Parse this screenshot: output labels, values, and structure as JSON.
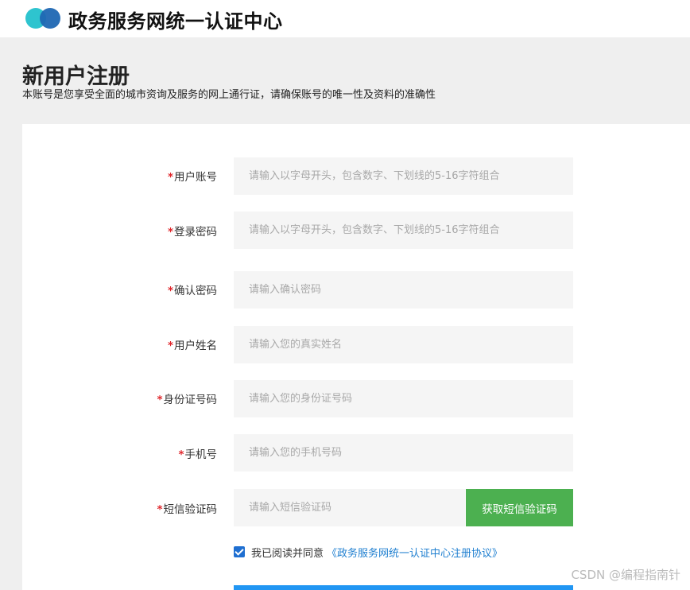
{
  "header": {
    "site_title": "政务服务网统一认证中心",
    "logo_icon": "two-circles-logo-icon"
  },
  "intro": {
    "title": "新用户注册",
    "subtitle": "本账号是您享受全面的城市资询及服务的网上通行证，请确保账号的唯一性及资料的准确性"
  },
  "form": {
    "required_mark": "*",
    "fields": [
      {
        "label": "用户账号",
        "placeholder": "请输入以字母开头，包含数字、下划线的5-16字符组合",
        "value": ""
      },
      {
        "label": "登录密码",
        "placeholder": "请输入以字母开头，包含数字、下划线的5-16字符组合",
        "value": ""
      },
      {
        "label": "确认密码",
        "placeholder": "请输入确认密码",
        "value": ""
      },
      {
        "label": "用户姓名",
        "placeholder": "请输入您的真实姓名",
        "value": ""
      },
      {
        "label": "身份证号码",
        "placeholder": "请输入您的身份证号码",
        "value": ""
      },
      {
        "label": "手机号",
        "placeholder": "请输入您的手机号码",
        "value": ""
      },
      {
        "label": "短信验证码",
        "placeholder": "请输入短信验证码",
        "value": ""
      }
    ],
    "sms_button_label": "获取短信验证码",
    "agreement": {
      "checked": true,
      "text": "我已阅读并同意",
      "link_text": "《政务服务网统一认证中心注册协议》"
    }
  },
  "colors": {
    "accent_blue": "#1f7fd0",
    "sms_button_green": "#4cb050",
    "required_red": "#e0262b"
  },
  "watermark": "CSDN @编程指南针"
}
